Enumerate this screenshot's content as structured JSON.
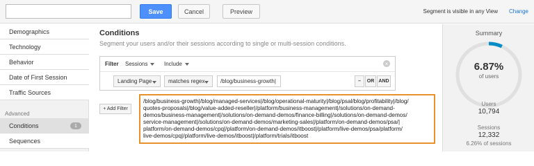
{
  "toolbar": {
    "segment_name_value": "",
    "save_label": "Save",
    "cancel_label": "Cancel",
    "preview_label": "Preview",
    "visibility_text": "Segment is visible in any View",
    "change_label": "Change"
  },
  "sidebar": {
    "items": [
      {
        "label": "Demographics"
      },
      {
        "label": "Technology"
      },
      {
        "label": "Behavior"
      },
      {
        "label": "Date of First Session"
      },
      {
        "label": "Traffic Sources"
      }
    ],
    "advanced_label": "Advanced",
    "advanced_items": [
      {
        "label": "Conditions",
        "count": "1"
      },
      {
        "label": "Sequences"
      }
    ]
  },
  "main": {
    "title": "Conditions",
    "subtitle": "Segment your users and/or their sessions according to single or multi-session conditions.",
    "filter": {
      "label": "Filter",
      "scope": "Sessions",
      "mode": "Include",
      "dimension": "Landing Page",
      "operator": "matches regex",
      "value": "/blog/business-growth|",
      "minus_label": "–",
      "or_label": "OR",
      "and_label": "AND"
    },
    "add_filter_label": "+ Add Filter",
    "regex_lines": [
      "/blog/business-growth|/blog/managed-services|/blog/operational-maturity|/blog/psal/blog/profitability|/blog/",
      "quotes-proposals|/blog/value-added-reseller|/platform/business-management|/solutions/on-demand-",
      "demos/business-management|/solutions/on-demand-demos/finance-billing|/solutions/on-demand-demos/",
      "service-management|/solutions/on-demand-demos/marketing-sales|/platform/on-demand-demos/psa/|",
      "platform/on-demand-demos/cpq|/platform/on-demand-demos/itboost|/platform/live-demos/psa/platform/",
      "live-demos/cpq|/platform/live-demos/itboost|/platform/trials/itboost"
    ]
  },
  "summary": {
    "title": "Summary",
    "percent": "6.87%",
    "percent_label": "of users",
    "percent_value": 0.0687,
    "users_label": "Users",
    "users_value": "10,794",
    "sessions_label": "Sessions",
    "sessions_value": "12,332",
    "sessions_note": "6.26% of sessions",
    "accent": "#058dc7",
    "ring_bg": "#e0e0e0"
  }
}
